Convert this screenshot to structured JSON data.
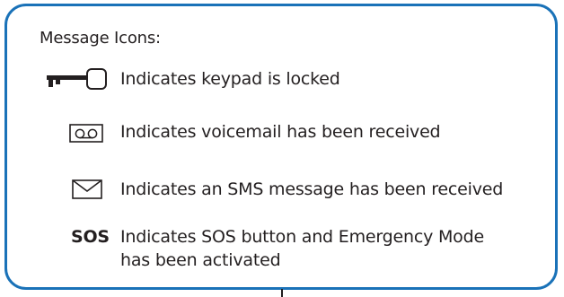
{
  "colors": {
    "border": "#1a72b8",
    "text": "#231f20"
  },
  "heading": "Message Icons:",
  "rows": [
    {
      "icon": "key-lock-icon",
      "text": "Indicates keypad is locked"
    },
    {
      "icon": "voicemail-icon",
      "text": "Indicates voicemail has been received"
    },
    {
      "icon": "envelope-icon",
      "text": "Indicates an SMS message has been received"
    },
    {
      "icon": "sos-label",
      "label": "SOS",
      "text_line1": "Indicates SOS button and Emergency Mode",
      "text_line2": "has been activated"
    }
  ]
}
